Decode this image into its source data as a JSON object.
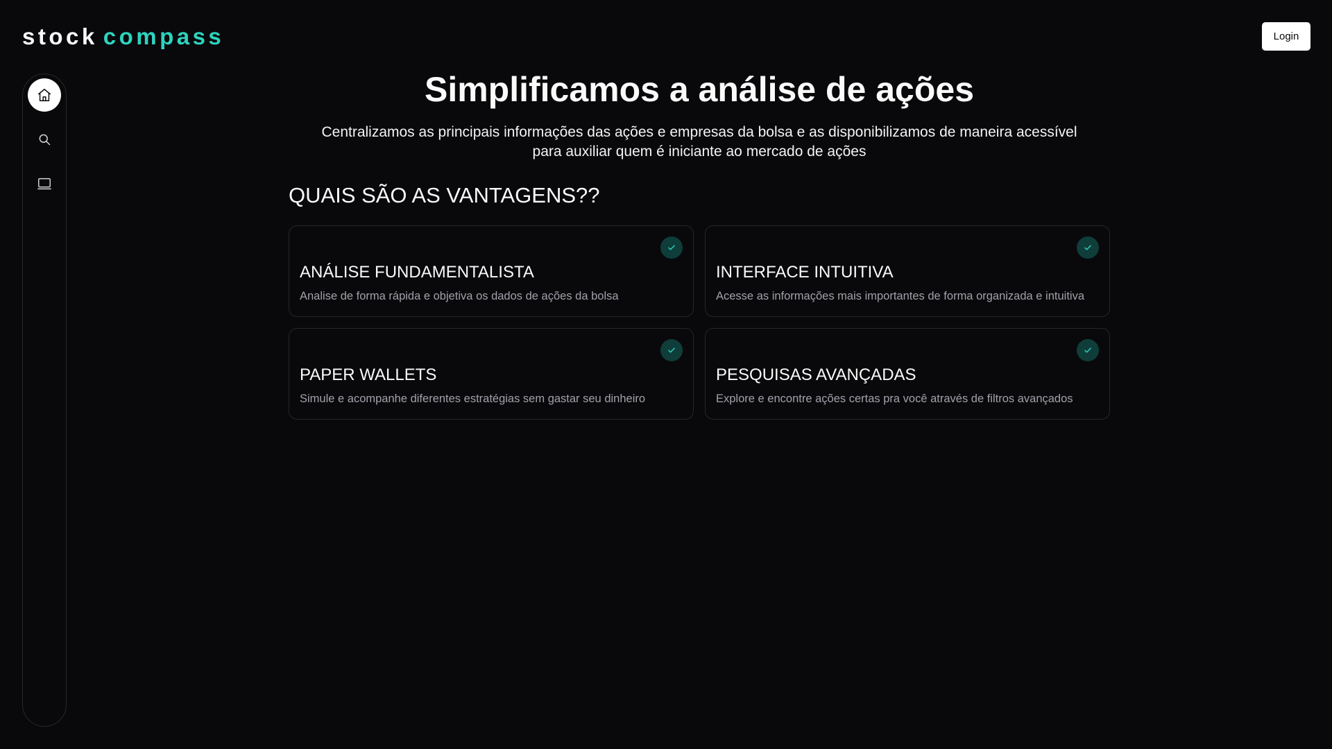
{
  "brand": {
    "word1": "stock",
    "word2": "compass",
    "accent_color": "#2dd4bf"
  },
  "header": {
    "login_label": "Login"
  },
  "sidebar": {
    "items": [
      {
        "icon": "home-icon",
        "active": true
      },
      {
        "icon": "search-icon",
        "active": false
      },
      {
        "icon": "monitor-icon",
        "active": false
      }
    ]
  },
  "hero": {
    "title": "Simplificamos a análise de ações",
    "subtitle": "Centralizamos as principais informações das ações e empresas da bolsa e as disponibilizamos de maneira acessível para auxiliar quem é iniciante ao mercado de ações"
  },
  "advantages": {
    "heading": "QUAIS SÃO AS VANTAGENS??",
    "cards": [
      {
        "title": "ANÁLISE FUNDAMENTALISTA",
        "description": "Analise de forma rápida e objetiva os dados de ações da bolsa"
      },
      {
        "title": "INTERFACE INTUITIVA",
        "description": "Acesse as informações mais importantes de forma organizada e intuitiva"
      },
      {
        "title": "PAPER WALLETS",
        "description": "Simule e acompanhe diferentes estratégias sem gastar seu dinheiro"
      },
      {
        "title": "PESQUISAS AVANÇADAS",
        "description": "Explore e encontre ações certas pra você através de filtros avançados"
      }
    ]
  }
}
